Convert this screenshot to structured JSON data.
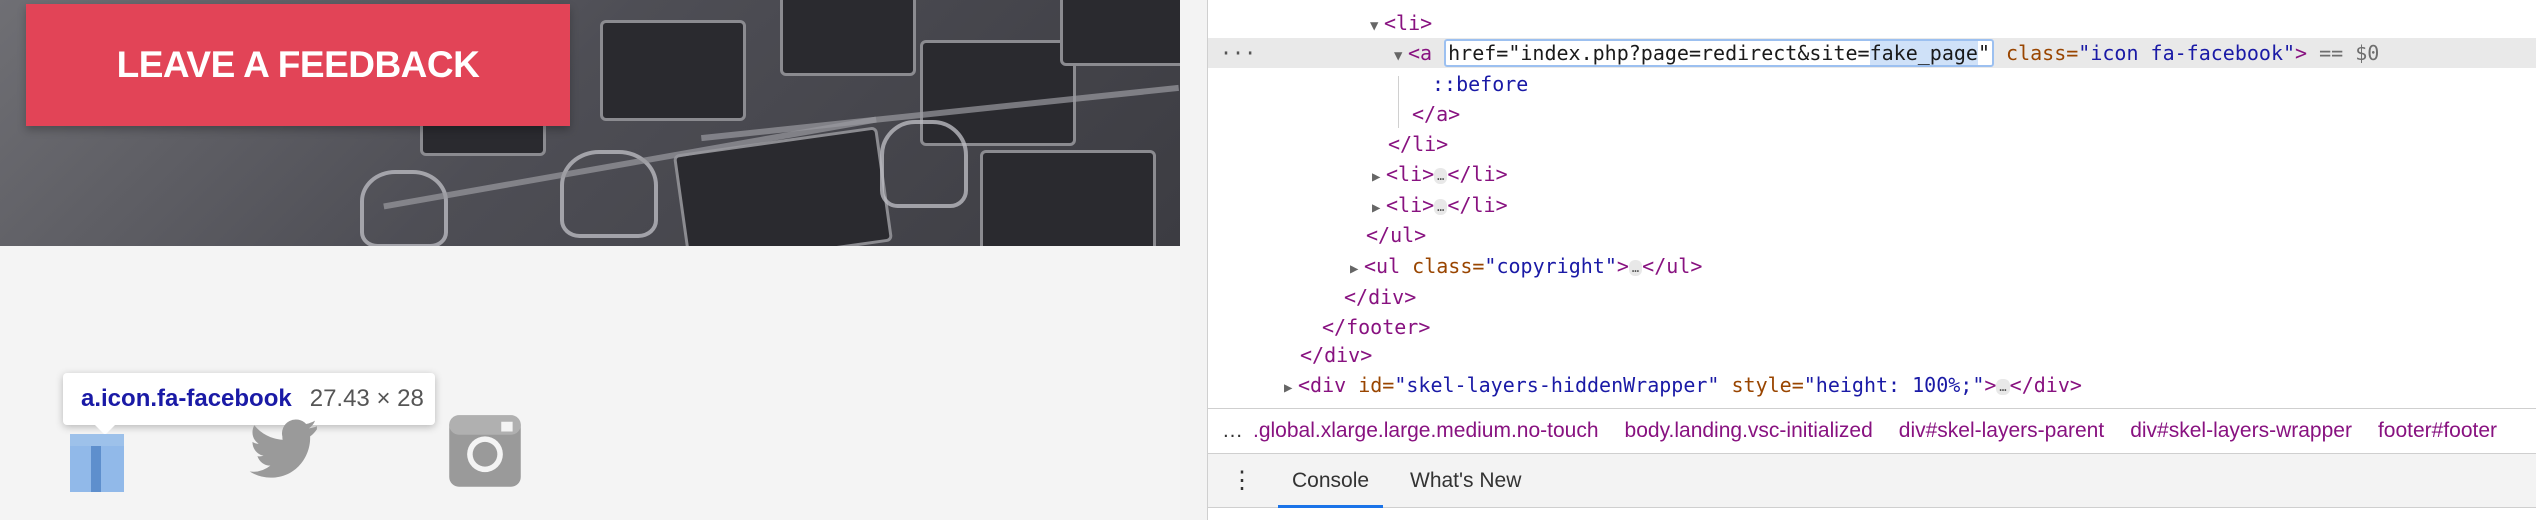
{
  "page": {
    "feedback_button": "LEAVE A FEEDBACK",
    "tooltip": {
      "selector": "a.icon.fa-facebook",
      "size": "27.43 × 28"
    }
  },
  "devtools": {
    "line_li_open": "<li>",
    "selected": {
      "tag_open": "<a",
      "attr_href": "href=\"index.php?page=redirect&site=",
      "attr_href_hl": "fake_page",
      "attr_href_end": "\"",
      "attr_class_name": "class=",
      "attr_class_value": "\"icon fa-facebook\"",
      "tag_close": ">",
      "eq": "== $0"
    },
    "pseudo": "::before",
    "a_close": "</a>",
    "li_close": "</li>",
    "li_collapsed_open": "<li>",
    "li_collapsed_close": "</li>",
    "ul_close": "</ul>",
    "ul_copyright_open": "<ul",
    "ul_copyright_attr": " class=",
    "ul_copyright_value": "\"copyright\"",
    "ul_copyright_tag_end": ">",
    "div_close": "</div>",
    "footer_close": "</footer>",
    "div_close2": "</div>",
    "hidden_wrapper_open": "<div",
    "hidden_wrapper_id": " id=",
    "hidden_wrapper_id_val": "\"skel-layers-hiddenWrapper\"",
    "hidden_wrapper_style": " style=",
    "hidden_wrapper_style_val": "\"height: 100%;\"",
    "hidden_wrapper_end": ">",
    "hidden_wrapper_close": "</div>",
    "ellipsis": "…",
    "breadcrumbs": [
      ".global.xlarge.large.medium.no-touch",
      "body.landing.vsc-initialized",
      "div#skel-layers-parent",
      "div#skel-layers-wrapper",
      "footer#footer"
    ],
    "drawer_tabs": [
      "Console",
      "What's New"
    ]
  },
  "colors": {
    "accent": "#e24457",
    "tag": "#881280",
    "attr_name": "#994500",
    "attr_value": "#1a1aa6",
    "active_tab": "#1a73e8"
  },
  "icons": [
    "facebook-icon",
    "twitter-icon",
    "instagram-icon",
    "kebab-menu-icon"
  ]
}
